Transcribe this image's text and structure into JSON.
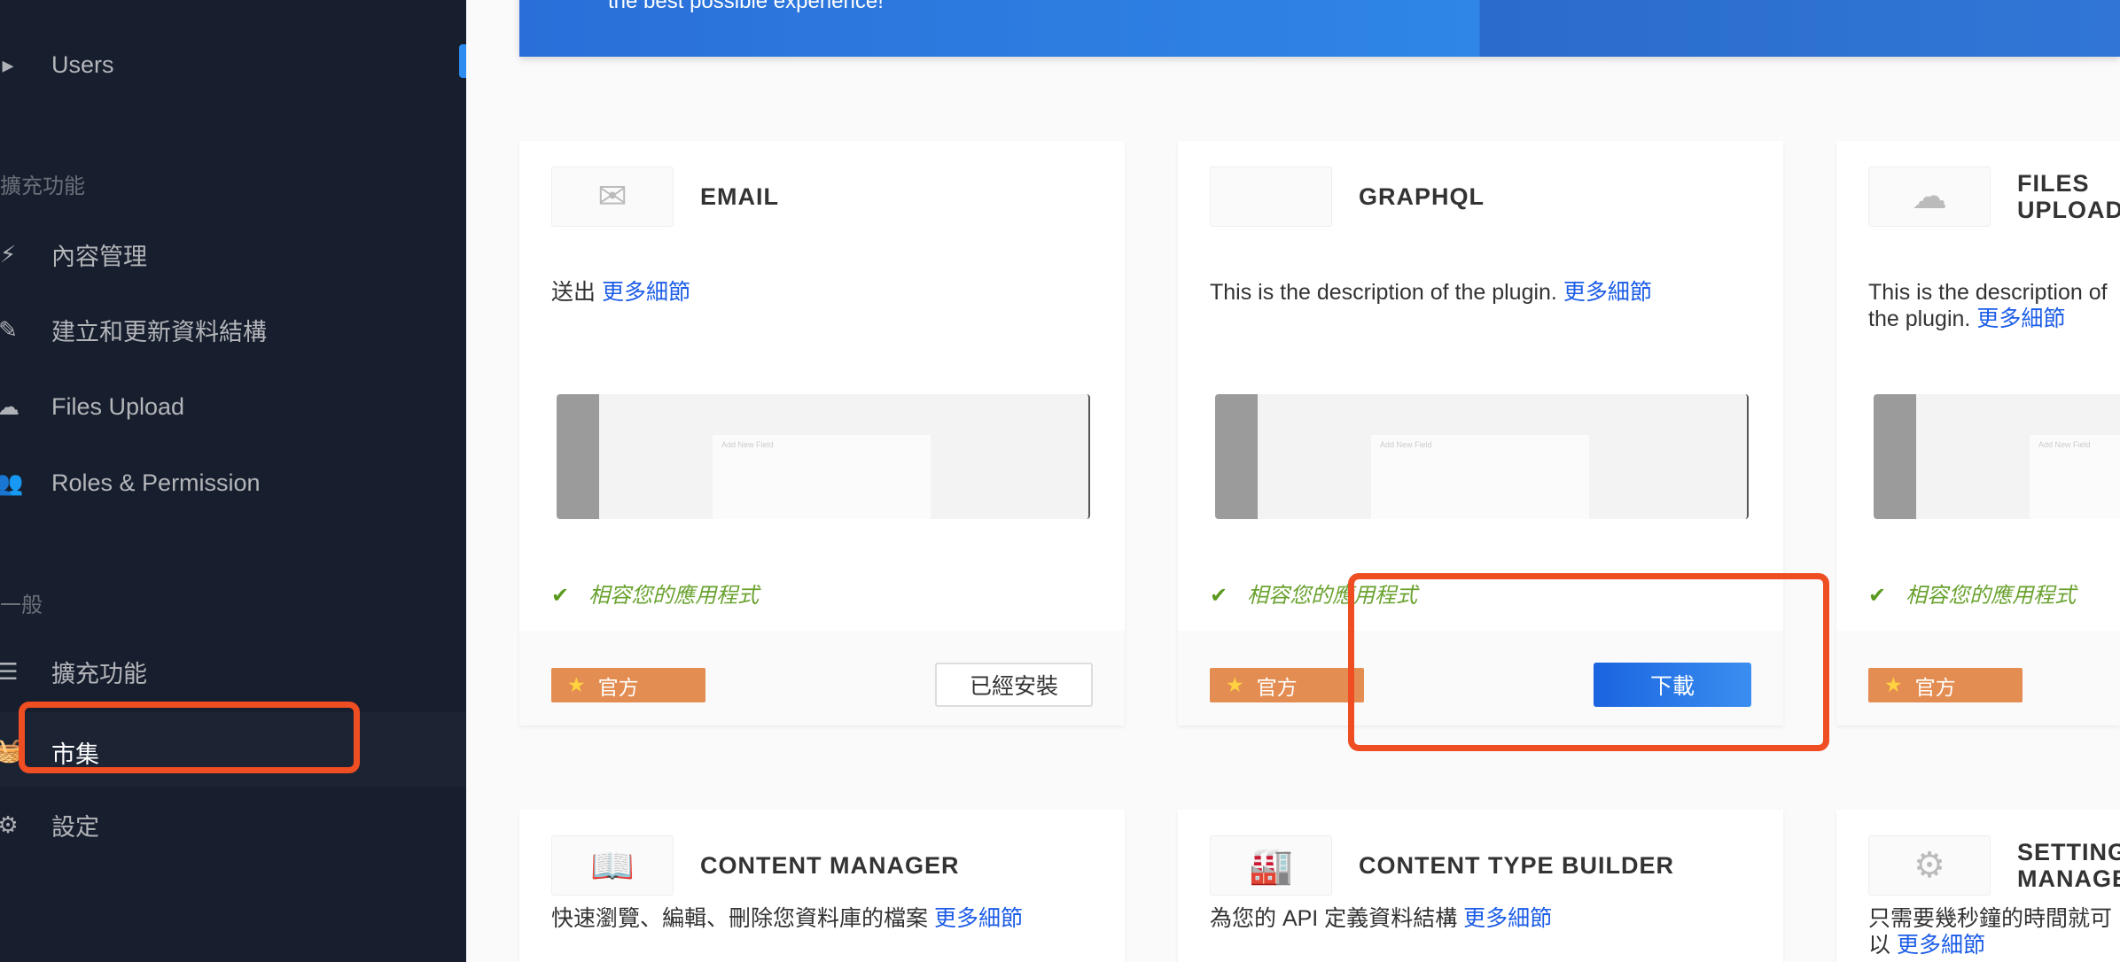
{
  "sidebar": {
    "items": [
      {
        "label": "Users",
        "icon": "caret-right-icon"
      },
      {
        "label": "內容管理",
        "icon": "plug-icon"
      },
      {
        "label": "建立和更新資料結構",
        "icon": "paint-brush-icon"
      },
      {
        "label": "Files Upload",
        "icon": "cloud-upload-icon"
      },
      {
        "label": "Roles & Permission",
        "icon": "users-icon"
      },
      {
        "label": "擴充功能",
        "icon": "list-icon"
      },
      {
        "label": "市集",
        "icon": "shopping-basket-icon",
        "active": true
      },
      {
        "label": "設定",
        "icon": "gear-icon"
      }
    ],
    "headers": [
      "擴充功能",
      "一般"
    ]
  },
  "banner": {
    "text": "the best possible experience!"
  },
  "common": {
    "more": "更多細節",
    "compatible": "相容您的應用程式",
    "official": "官方"
  },
  "cards": [
    {
      "title": "EMAIL",
      "icon": "envelope-icon",
      "desc": "送出",
      "button": "已經安裝"
    },
    {
      "title": "GRAPHQL",
      "icon": "blank-icon",
      "desc": "This is the description of the plugin.",
      "button": "下載"
    },
    {
      "title": "FILES UPLOAD",
      "icon": "cloud-upload-icon",
      "desc": "This is the description of the plugin."
    },
    {
      "title": "CONTENT MANAGER",
      "icon": "book-icon",
      "desc": "快速瀏覽、編輯、刪除您資料庫的檔案"
    },
    {
      "title": "CONTENT TYPE BUILDER",
      "icon": "factory-icon",
      "desc": "為您的 API 定義資料結構"
    },
    {
      "title": "SETTINGS MANAGER",
      "icon": "gears-icon",
      "desc": "只需要幾秒鐘的時間就可以"
    }
  ],
  "preview": {
    "text": "Add New Field"
  },
  "colors": {
    "sidebar": "#171f2e",
    "accent": "#1c5de7",
    "official": "#e48d52",
    "highlight": "#ef4d22"
  }
}
